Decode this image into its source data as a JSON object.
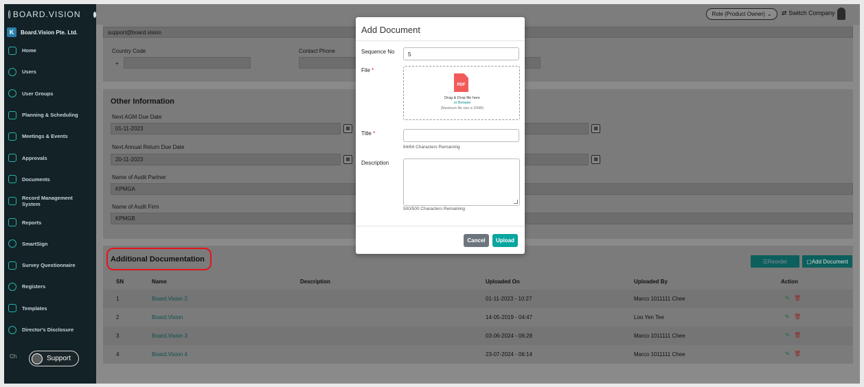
{
  "sidebar": {
    "brand": "BOARD.VISION",
    "company": "Board.Vision Pte. Ltd.",
    "company_icon": "K",
    "items": [
      {
        "label": "Home",
        "icon": "home-icon"
      },
      {
        "label": "Users",
        "icon": "user-icon"
      },
      {
        "label": "User Groups",
        "icon": "user-group-icon"
      },
      {
        "label": "Planning & Scheduling",
        "icon": "planning-icon"
      },
      {
        "label": "Meetings & Events",
        "icon": "calendar-icon"
      },
      {
        "label": "Approvals",
        "icon": "approvals-icon"
      },
      {
        "label": "Documents",
        "icon": "documents-icon"
      },
      {
        "label": "Record Management System",
        "icon": "records-icon"
      },
      {
        "label": "Reports",
        "icon": "reports-icon"
      },
      {
        "label": "SmartSign",
        "icon": "smartsign-icon"
      },
      {
        "label": "Survey Questionnaire",
        "icon": "survey-icon"
      },
      {
        "label": "Registers",
        "icon": "registers-icon"
      },
      {
        "label": "Templates",
        "icon": "templates-icon"
      },
      {
        "label": "Director's Disclosure",
        "icon": "disclosure-icon"
      }
    ],
    "chat_hint": "Ch",
    "support_label": "Support"
  },
  "topbar": {
    "role": "Role (Product Owner)",
    "switch_company": "Switch Company"
  },
  "contact": {
    "email": "support@board.vision",
    "country_code_label": "Country Code",
    "country_code_prefix": "+",
    "contact_phone_label": "Contact Phone"
  },
  "other_info": {
    "title": "Other Information",
    "agm_label": "Next AGM Due Date",
    "agm_value": "01-11-2023",
    "annual_label": "Next Annual Return Due Date",
    "annual_value": "20-11-2023",
    "audit_partner_label": "Name of Audit Partner",
    "audit_partner_value": "KPMGA",
    "audit_firm_label": "Name of Audit Firm",
    "audit_firm_value": "KPMGB"
  },
  "additional": {
    "title": "Additional Documentation",
    "reorder_label": "Reorder",
    "add_doc_label": "Add Document",
    "columns": [
      "SN",
      "Name",
      "Description",
      "Uploaded On",
      "Uploaded By",
      "Action"
    ],
    "rows": [
      {
        "sn": "1",
        "name": "Board.Vision 2",
        "description": "",
        "uploaded_on": "01-11-2023 - 10:27",
        "uploaded_by": "Marco 1011111 Chee"
      },
      {
        "sn": "2",
        "name": "Board.Vision",
        "description": "",
        "uploaded_on": "14-05-2019 - 04:47",
        "uploaded_by": "Loo Yen Tee"
      },
      {
        "sn": "3",
        "name": "Board.Vision 3",
        "description": "",
        "uploaded_on": "03-06-2024 - 06:28",
        "uploaded_by": "Marco 1011111 Chee"
      },
      {
        "sn": "4",
        "name": "Board.Vision 4",
        "description": "",
        "uploaded_on": "23-07-2024 - 06:14",
        "uploaded_by": "Marco 1011111 Chee"
      }
    ]
  },
  "modal": {
    "title": "Add Document",
    "sequence_label": "Sequence No",
    "sequence_value": "5",
    "file_label": "File",
    "required_mark": "*",
    "pdf_text": "PDF",
    "drop_text": "Drag & Drop file here",
    "browse_text": "or Browse",
    "max_size_text": "(Maximum file size is 20MB)",
    "title_label": "Title",
    "title_hint": "64/64 Characters Remaining",
    "description_label": "Description",
    "description_hint": "500/500 Characters Remaining",
    "cancel_label": "Cancel",
    "upload_label": "Upload"
  }
}
